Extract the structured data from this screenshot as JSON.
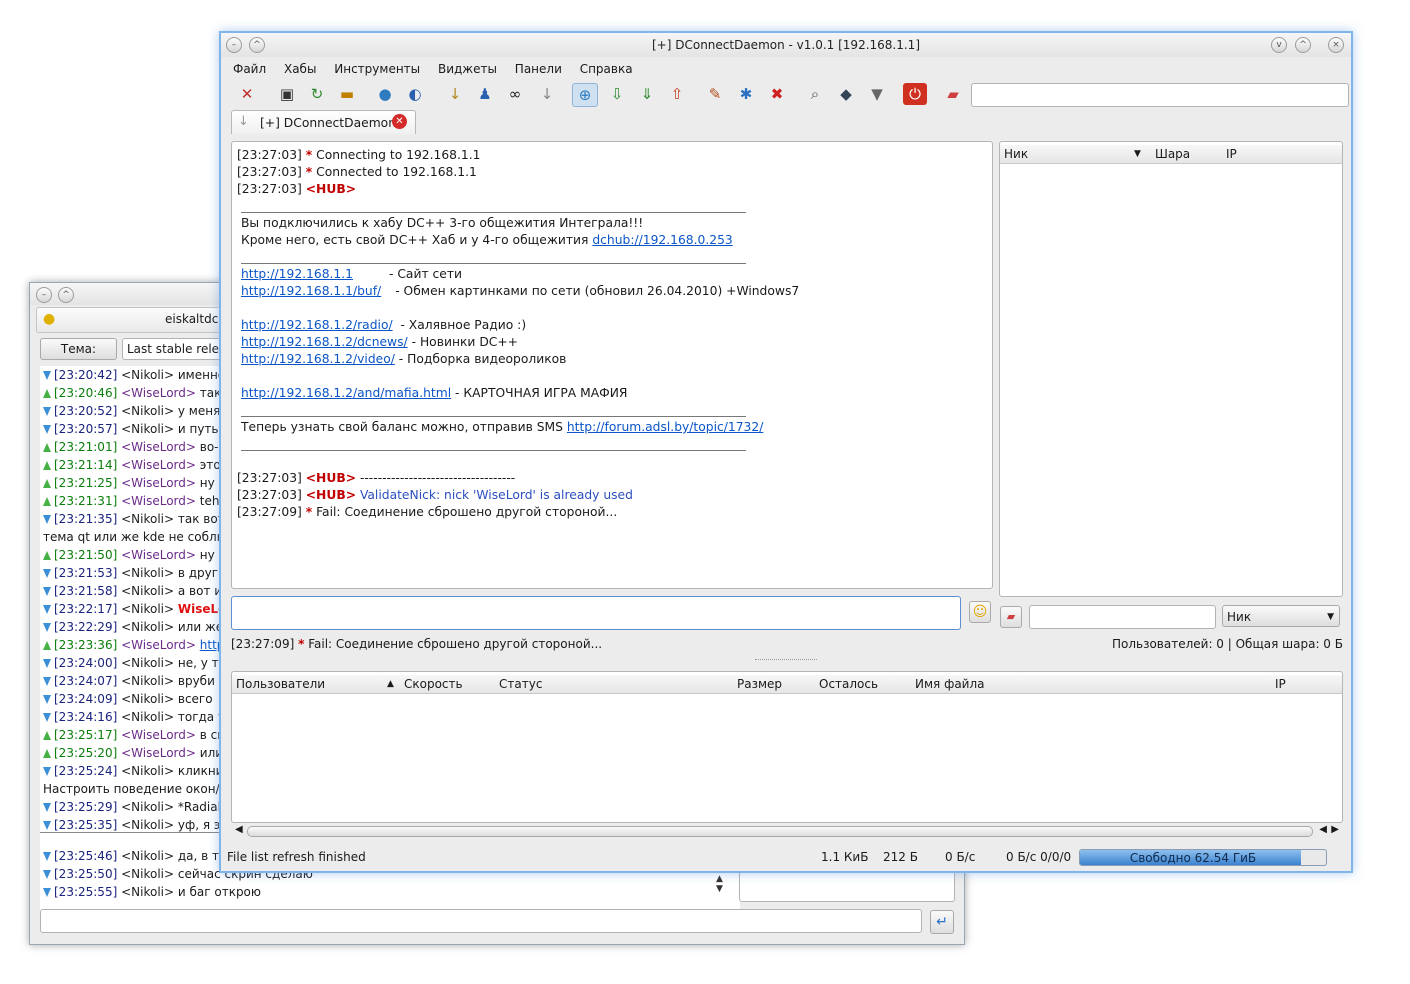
{
  "back_window": {
    "title": "eiskaltdc",
    "topic_label": "Тема:",
    "topic_value": "Last stable relea",
    "messages": [
      {
        "dir": "down",
        "time": "[23:20:42]",
        "nick": "<Nikoli>",
        "text": "именно",
        "who": "n"
      },
      {
        "dir": "up",
        "time": "[23:20:46]",
        "nick": "<WiseLord>",
        "text": "такс",
        "who": "w"
      },
      {
        "dir": "down",
        "time": "[23:20:52]",
        "nick": "<Nikoli>",
        "text": "у меня",
        "who": "n"
      },
      {
        "dir": "down",
        "time": "[23:20:57]",
        "nick": "<Nikoli>",
        "text": "и путь д",
        "who": "n"
      },
      {
        "dir": "up",
        "time": "[23:21:01]",
        "nick": "<WiseLord>",
        "text": "во-п",
        "who": "w"
      },
      {
        "dir": "up",
        "time": "[23:21:14]",
        "nick": "<WiseLord>",
        "text": "этот",
        "who": "w"
      },
      {
        "dir": "up",
        "time": "[23:21:25]",
        "nick": "<WiseLord>",
        "text": "ну и",
        "who": "w"
      },
      {
        "dir": "up",
        "time": "[23:21:31]",
        "nick": "<WiseLord>",
        "text": "tehn",
        "who": "w"
      },
      {
        "dir": "down",
        "time": "[23:21:35]",
        "nick": "<Nikoli>",
        "text": "так вот",
        "who": "n"
      },
      {
        "dir": "none",
        "time": "",
        "nick": "",
        "text": "тема qt или же kde не соблюд",
        "who": "n"
      },
      {
        "dir": "up",
        "time": "[23:21:50]",
        "nick": "<WiseLord>",
        "text": "ну н",
        "who": "w"
      },
      {
        "dir": "down",
        "time": "[23:21:53]",
        "nick": "<Nikoli>",
        "text": "в други",
        "who": "n"
      },
      {
        "dir": "down",
        "time": "[23:21:58]",
        "nick": "<Nikoli>",
        "text": "а вот и",
        "who": "n"
      },
      {
        "dir": "down",
        "time": "[23:22:17]",
        "nick": "<Nikoli>",
        "text": "WiseLo",
        "who": "n",
        "hl": true
      },
      {
        "dir": "down",
        "time": "[23:22:29]",
        "nick": "<Nikoli>",
        "text": "или же",
        "who": "n"
      },
      {
        "dir": "up",
        "time": "[23:23:36]",
        "nick": "<WiseLord>",
        "text": "http",
        "who": "w",
        "link": true
      },
      {
        "dir": "down",
        "time": "[23:24:00]",
        "nick": "<Nikoli>",
        "text": "не, у те",
        "who": "n"
      },
      {
        "dir": "down",
        "time": "[23:24:07]",
        "nick": "<Nikoli>",
        "text": "вруби т",
        "who": "n"
      },
      {
        "dir": "down",
        "time": "[23:24:09]",
        "nick": "<Nikoli>",
        "text": "всего",
        "who": "n"
      },
      {
        "dir": "down",
        "time": "[23:24:16]",
        "nick": "<Nikoli>",
        "text": "тогда у",
        "who": "n"
      },
      {
        "dir": "up",
        "time": "[23:25:17]",
        "nick": "<WiseLord>",
        "text": "в си",
        "who": "w"
      },
      {
        "dir": "up",
        "time": "[23:25:20]",
        "nick": "<WiseLord>",
        "text": "или",
        "who": "w"
      },
      {
        "dir": "down",
        "time": "[23:25:24]",
        "nick": "<Nikoli>",
        "text": "кликни",
        "who": "n"
      },
      {
        "dir": "none",
        "time": "",
        "nick": "",
        "text": "Настроить поведение окон/ С",
        "who": "n"
      },
      {
        "dir": "down",
        "time": "[23:25:29]",
        "nick": "<Nikoli>",
        "text": "*Radial",
        "who": "n"
      },
      {
        "dir": "down",
        "time": "[23:25:35]",
        "nick": "<Nikoli>",
        "text": "уф, я эт",
        "who": "n"
      }
    ],
    "bottom_messages": [
      {
        "dir": "down",
        "time": "[23:25:46]",
        "nick": "<Nikoli>",
        "text": "да, в те",
        "who": "n"
      },
      {
        "dir": "down",
        "time": "[23:25:50]",
        "nick": "<Nikoli>",
        "text": "сейчас скрин сделаю",
        "who": "n"
      },
      {
        "dir": "down",
        "time": "[23:25:55]",
        "nick": "<Nikoli>",
        "text": "и баг открою",
        "who": "n"
      }
    ]
  },
  "front_window": {
    "title": "[+] DConnectDaemon - v1.0.1 [192.168.1.1]",
    "menu": [
      "Файл",
      "Хабы",
      "Инструменты",
      "Виджеты",
      "Панели",
      "Справка"
    ],
    "tab_label": "[+] DConnectDaemon",
    "toolbar_icons": [
      "connect-tools-icon",
      "hub-list-icon",
      "reconnect-icon",
      "fav-hubs-icon",
      "globe-icon",
      "public-hubs-icon",
      "download-queue-icon",
      "users-icon",
      "search-binoculars-icon",
      "pin-icon",
      "quick-connect-icon",
      "download-icon",
      "finished-downloads-icon",
      "upload-icon",
      "clear-icon",
      "search-spy-icon",
      "remove-icon",
      "adl-search-icon",
      "shield-icon",
      "filter-icon",
      "quit-icon",
      "eraser-icon"
    ],
    "chat": {
      "l1_time": "[23:27:03]",
      "l1_star": "*",
      "l1_text": "Connecting to 192.168.1.1",
      "l2_time": "[23:27:03]",
      "l2_star": "*",
      "l2_text": "Connected to 192.168.1.1",
      "l3_time": "[23:27:03]",
      "l3_hub": "<HUB>",
      "welcome": "Вы подключились к хабу DC++ 3-го общежития Интеграла!!!",
      "also_text": "Кроме него, есть свой DC++ Хаб и у 4-го общежития",
      "also_link": "dchub://192.168.0.253",
      "link1": "http://192.168.1.1",
      "link1_desc": "- Сайт сети",
      "link2": "http://192.168.1.1/buf/",
      "link2_desc": "- Обмен картинками по сети (обновил 26.04.2010) +Windows7",
      "link3": "http://192.168.1.2/radio/",
      "link3_desc": "- Халявное Радио :)",
      "link4": "http://192.168.1.2/dcnews/",
      "link4_desc": "- Новинки DC++",
      "link5": "http://192.168.1.2/video/",
      "link5_desc": "- Подборка видеороликов",
      "link6": "http://192.168.1.2/and/mafia.html",
      "link6_desc": "- КАРТОЧНАЯ ИГРА МАФИЯ",
      "balance_text": "Теперь узнать свой баланс можно, отправив SMS",
      "balance_link": "http://forum.adsl.by/topic/1732/",
      "l4_time": "[23:27:03]",
      "l4_hub": "<HUB>",
      "l4_text": "-----------------------------------",
      "l5_time": "[23:27:03]",
      "l5_hub": "<HUB>",
      "l5_text": "ValidateNick: nick 'WiseLord' is already used",
      "l6_time": "[23:27:09]",
      "l6_star": "*",
      "l6_text": "Fail: Соединение сброшено другой стороной..."
    },
    "userlist_headers": [
      "Ник",
      "Шара",
      "IP"
    ],
    "filter_combo": "Ник",
    "status_time": "[23:27:09]",
    "status_star": "*",
    "status_text": "Fail: Соединение сброшено другой стороной...",
    "users_summary": "Пользователей: 0 | Общая шара: 0 Б",
    "transfer_headers": [
      "Пользователи",
      "Скорость",
      "Статус",
      "Размер",
      "Осталось",
      "Имя файла",
      "IP"
    ],
    "statusbar": {
      "message": "File list refresh finished",
      "filelist_size": "1.1 КиБ",
      "size2": "212 Б",
      "speed_down": "0 Б/с",
      "speed_up": "0 Б/с 0/0/0",
      "free_space": "Свободно 62.54 ГиБ"
    },
    "free_space_fraction": 0.9
  }
}
